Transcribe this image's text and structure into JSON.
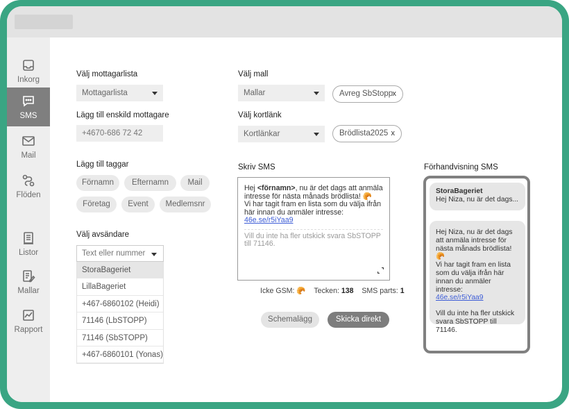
{
  "sidebar": {
    "items": [
      {
        "label": "Inkorg",
        "icon": "inbox-icon"
      },
      {
        "label": "SMS",
        "icon": "sms-icon"
      },
      {
        "label": "Mail",
        "icon": "mail-icon"
      },
      {
        "label": "Flöden",
        "icon": "flow-icon"
      },
      {
        "label": "Listor",
        "icon": "list-icon"
      },
      {
        "label": "Mallar",
        "icon": "template-icon"
      },
      {
        "label": "Rapport",
        "icon": "report-icon"
      }
    ]
  },
  "recipients": {
    "list_heading": "Välj mottagarlista",
    "list_value": "Mottagarlista",
    "single_heading": "Lägg till enskild mottagare",
    "single_placeholder": "+4670-686 72 42"
  },
  "template": {
    "heading": "Välj mall",
    "value": "Mallar",
    "chip": "Avreg SbStopp"
  },
  "shortlink": {
    "heading": "Välj kortlänk",
    "value": "Kortlänkar",
    "chip": "Brödlista2025"
  },
  "tags": {
    "heading": "Lägg till taggar",
    "items": [
      "Förnamn",
      "Efternamn",
      "Mail",
      "Företag",
      "Event",
      "Medlemsnr"
    ]
  },
  "sender": {
    "heading": "Välj avsändare",
    "placeholder": "Text eller nummer",
    "options": [
      "StoraBageriet",
      "LillaBageriet",
      "+467-6860102 (Heidi)",
      "71146 (LbSTOPP)",
      "71146 (SbSTOPP)",
      "+467-6860101 (Yonas)"
    ],
    "selected": "StoraBageriet"
  },
  "compose": {
    "heading": "Skriv SMS",
    "greeting": "Hej ",
    "name_tag": "<förnamn>",
    "line1_rest": ", nu är det dags att anmäla intresse för nästa månads brödlista! 🥐",
    "line2": "Vi har tagit fram en lista som du  välja ifrån här innan du anmäler intresse:",
    "link": "46e.se/r5iYaa9",
    "footer": "Vill du inte ha fler utskick svara SbSTOPP till 71146."
  },
  "stats": {
    "gsm_label": "Icke GSM:",
    "gsm_value": "🥐",
    "chars_label": "Tecken:",
    "chars_value": "138",
    "parts_label": "SMS parts:",
    "parts_value": "1"
  },
  "buttons": {
    "schedule": "Schemalägg",
    "send": "Skicka direkt"
  },
  "preview": {
    "heading": "Förhandvisning SMS",
    "sender": "StoraBageriet",
    "snippet": "Hej Niza, nu är det dags...",
    "body1": "Hej Niza, nu är det dags att anmäla intresse för nästa månads brödlista! 🥐",
    "body2": "Vi har tagit fram en lista som du välja ifrån här innan du anmäler intresse:",
    "link": "46e.se/r5iYaa9",
    "footer": "Vill du inte ha fler utskick svara SbSTOPP till 71146."
  },
  "colors": {
    "frame": "#3aa583",
    "active_nav": "#7f7f7f",
    "link": "#3b5bd6"
  }
}
